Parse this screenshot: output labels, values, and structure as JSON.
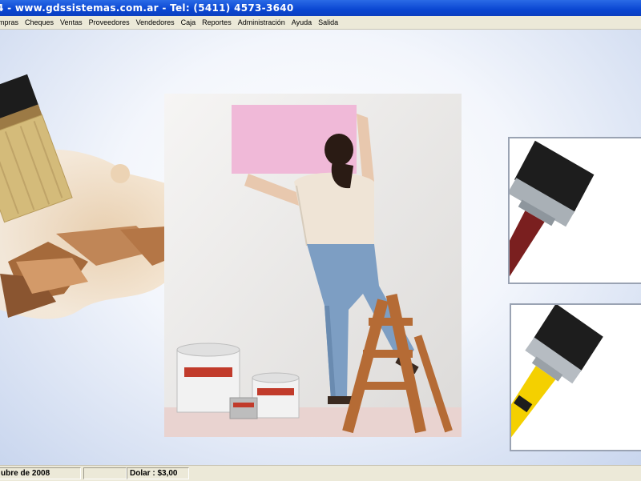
{
  "window": {
    "title": "4 - www.gdssistemas.com.ar - Tel: (5411) 4573-3640"
  },
  "menu": {
    "items": [
      "mpras",
      "Cheques",
      "Ventas",
      "Proveedores",
      "Vendedores",
      "Caja",
      "Reportes",
      "Administración",
      "Ayuda",
      "Salida"
    ]
  },
  "status": {
    "date": "ubre de 2008",
    "empty": "",
    "dolar": "Dolar : $3,00"
  },
  "colors": {
    "titlebar": "#0a46d2",
    "menubar": "#ece9d8",
    "wall_paper": "#f0b9d8",
    "brush_bristles": "#1d1d1d",
    "red_handle": "#7a1f1f",
    "yellow_handle": "#f4d000"
  },
  "images": {
    "left_brush": "paint-brush-with-paint-splash-image",
    "center": "woman-painting-wall-on-ladder-image",
    "right_top": "brush-red-handle-image",
    "right_bottom": "brush-yellow-handle-image"
  }
}
